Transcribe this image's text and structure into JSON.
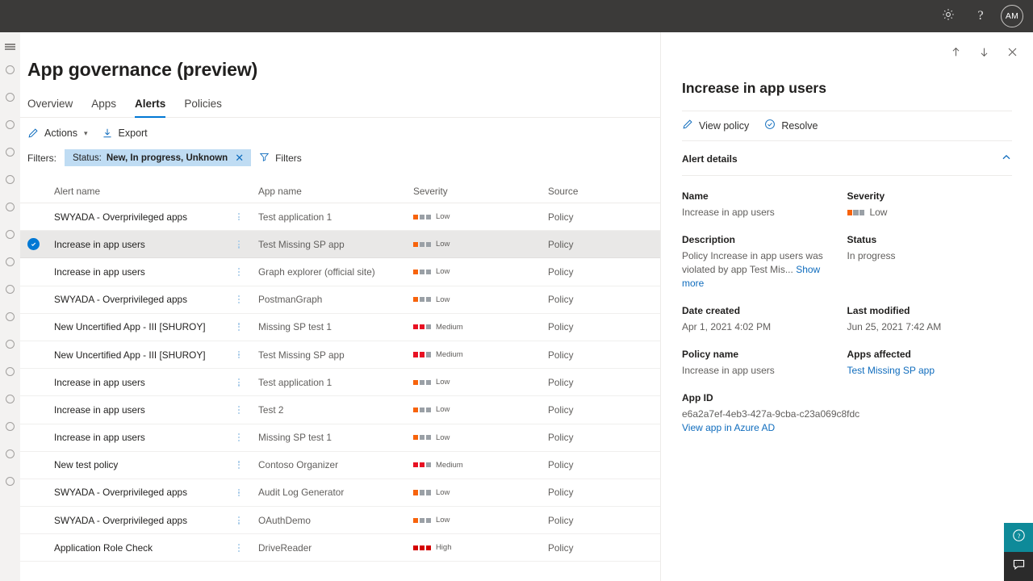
{
  "suitebar": {
    "settings_icon": "gear-icon",
    "help_icon": "question-icon",
    "avatar_initials": "AM"
  },
  "rail": {
    "hamburger_icon": "hamburger-icon",
    "item_count": 16
  },
  "page": {
    "title": "App governance (preview)",
    "tabs": [
      {
        "label": "Overview",
        "active": false
      },
      {
        "label": "Apps",
        "active": false
      },
      {
        "label": "Alerts",
        "active": true
      },
      {
        "label": "Policies",
        "active": false
      }
    ]
  },
  "commandbar": {
    "actions_label": "Actions",
    "actions_icon": "pencil-icon",
    "export_label": "Export",
    "export_icon": "download-icon"
  },
  "filters": {
    "label": "Filters:",
    "pill_prefix": "Status:",
    "pill_value": "New, In progress, Unknown",
    "pill_close_icon": "close-icon",
    "filters_button_label": "Filters",
    "filters_button_icon": "funnel-icon"
  },
  "table": {
    "columns": [
      "Alert name",
      "App name",
      "Severity",
      "Source"
    ],
    "rows": [
      {
        "alert": "SWYADA - Overprivileged apps",
        "app": "Test application 1",
        "severity": "Low",
        "source": "Policy",
        "selected": false
      },
      {
        "alert": "Increase in app users",
        "app": "Test Missing SP app",
        "severity": "Low",
        "source": "Policy",
        "selected": true
      },
      {
        "alert": "Increase in app users",
        "app": "Graph explorer (official site)",
        "severity": "Low",
        "source": "Policy",
        "selected": false
      },
      {
        "alert": "SWYADA - Overprivileged apps",
        "app": "PostmanGraph",
        "severity": "Low",
        "source": "Policy",
        "selected": false
      },
      {
        "alert": "New Uncertified App - III [SHUROY]",
        "app": "Missing SP test 1",
        "severity": "Medium",
        "source": "Policy",
        "selected": false
      },
      {
        "alert": "New Uncertified App - III [SHUROY]",
        "app": "Test Missing SP app",
        "severity": "Medium",
        "source": "Policy",
        "selected": false
      },
      {
        "alert": "Increase in app users",
        "app": "Test application 1",
        "severity": "Low",
        "source": "Policy",
        "selected": false
      },
      {
        "alert": "Increase in app users",
        "app": "Test 2",
        "severity": "Low",
        "source": "Policy",
        "selected": false
      },
      {
        "alert": "Increase in app users",
        "app": "Missing SP test 1",
        "severity": "Low",
        "source": "Policy",
        "selected": false
      },
      {
        "alert": "New test policy",
        "app": "Contoso Organizer",
        "severity": "Medium",
        "source": "Policy",
        "selected": false
      },
      {
        "alert": "SWYADA - Overprivileged apps",
        "app": "Audit Log Generator",
        "severity": "Low",
        "source": "Policy",
        "selected": false
      },
      {
        "alert": "SWYADA - Overprivileged apps",
        "app": "OAuthDemo",
        "severity": "Low",
        "source": "Policy",
        "selected": false
      },
      {
        "alert": "Application Role Check",
        "app": "DriveReader",
        "severity": "High",
        "source": "Policy",
        "selected": false
      }
    ]
  },
  "severity_colors": {
    "Low": {
      "filled": 1,
      "color": "#f7630c"
    },
    "Medium": {
      "filled": 2,
      "color": "#e81123"
    },
    "High": {
      "filled": 3,
      "color": "#d40000"
    },
    "empty": "#9aa0a6"
  },
  "panel": {
    "nav": {
      "up_icon": "arrow-up-icon",
      "down_icon": "arrow-down-icon",
      "close_icon": "close-icon"
    },
    "title": "Increase in app users",
    "actions": [
      {
        "label": "View policy",
        "icon": "pencil-icon"
      },
      {
        "label": "Resolve",
        "icon": "check-circle-icon"
      }
    ],
    "section": {
      "title": "Alert details",
      "collapse_icon": "chevron-up-icon"
    },
    "fields": {
      "name_label": "Name",
      "name_value": "Increase in app users",
      "severity_label": "Severity",
      "severity_value": "Low",
      "description_label": "Description",
      "description_value": "Policy Increase in app users was violated by app Test Mis...",
      "description_more": "Show more",
      "status_label": "Status",
      "status_value": "In progress",
      "date_created_label": "Date created",
      "date_created_value": "Apr 1, 2021 4:02 PM",
      "last_modified_label": "Last modified",
      "last_modified_value": "Jun 25, 2021 7:42 AM",
      "policy_name_label": "Policy name",
      "policy_name_value": "Increase in app users",
      "apps_affected_label": "Apps affected",
      "apps_affected_value": "Test Missing SP app",
      "app_id_label": "App ID",
      "app_id_value": "e6a2a7ef-4eb3-427a-9cba-c23a069c8fdc",
      "app_id_link": "View app in Azure AD"
    }
  },
  "fab": {
    "help_icon": "help-circle-icon",
    "feedback_icon": "feedback-chat-icon",
    "help_color": "#0e8a99",
    "feedback_color": "#2b2b2b"
  },
  "colors": {
    "accent": "#0078d4",
    "link": "#0f6cbd",
    "suitebar": "#3b3a39"
  }
}
